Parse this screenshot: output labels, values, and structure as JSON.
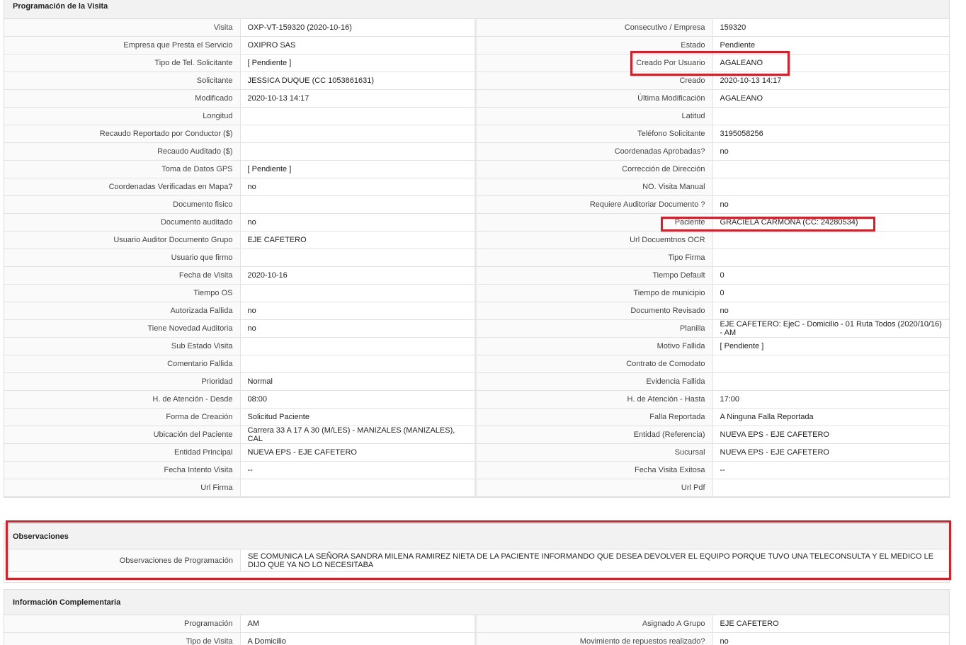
{
  "programacion": {
    "title": "Programación de la Visita",
    "rows": [
      {
        "l1": "Visita",
        "v1": "OXP-VT-159320 (2020-10-16)",
        "l2": "Consecutivo / Empresa",
        "v2": "159320"
      },
      {
        "l1": "Empresa que Presta el Servicio",
        "v1": "OXIPRO SAS",
        "l2": "Estado",
        "v2": "Pendiente"
      },
      {
        "l1": "Tipo de Tel. Solicitante",
        "v1": "[ Pendiente ]",
        "l2": "Creado Por Usuario",
        "v2": "AGALEANO"
      },
      {
        "l1": "Solicitante",
        "v1": "JESSICA DUQUE (CC 1053861631)",
        "l2": "Creado",
        "v2": "2020-10-13 14:17"
      },
      {
        "l1": "Modificado",
        "v1": "2020-10-13 14:17",
        "l2": "Última Modificación",
        "v2": " AGALEANO"
      },
      {
        "l1": "Longitud",
        "v1": "",
        "l2": "Latitud",
        "v2": ""
      },
      {
        "l1": "Recaudo Reportado por Conductor ($)",
        "v1": "",
        "l2": "Teléfono Solicitante",
        "v2": "3195058256"
      },
      {
        "l1": "Recaudo Auditado ($)",
        "v1": "",
        "l2": "Coordenadas Aprobadas?",
        "v2": " no"
      },
      {
        "l1": "Toma de Datos GPS",
        "v1": "[ Pendiente ]",
        "l2": "Corrección de Dirección",
        "v2": ""
      },
      {
        "l1": "Coordenadas Verificadas en Mapa?",
        "v1": " no",
        "l2": "NO. Visita Manual",
        "v2": ""
      },
      {
        "l1": "Documento fisico",
        "v1": "",
        "l2": "Requiere Auditoriar Documento ?",
        "v2": " no"
      },
      {
        "l1": "Documento auditado",
        "v1": " no",
        "l2": "Paciente",
        "v2": "GRACIELA CARMONA (CC: 24280534)"
      },
      {
        "l1": "Usuario Auditor Documento Grupo",
        "v1": "EJE CAFETERO",
        "l2": "Url Docuemtnos OCR",
        "v2": ""
      },
      {
        "l1": "Usuario que firmo",
        "v1": "",
        "l2": "Tipo Firma",
        "v2": ""
      },
      {
        "l1": "Fecha de Visita",
        "v1": " 2020-10-16",
        "l2": "Tiempo Default",
        "v2": "0"
      },
      {
        "l1": "Tiempo OS",
        "v1": "",
        "l2": "Tiempo de municipio",
        "v2": "0"
      },
      {
        "l1": "Autorizada Fallida",
        "v1": " no",
        "l2": "Documento Revisado",
        "v2": " no"
      },
      {
        "l1": "Tiene Novedad Auditoria",
        "v1": " no",
        "l2": "Planilla",
        "v2": "EJE CAFETERO: EjeC - Domicilio - 01 Ruta Todos (2020/10/16) - AM"
      },
      {
        "l1": "Sub Estado Visita",
        "v1": "",
        "l2": "Motivo Fallida",
        "v2": "[ Pendiente ]"
      },
      {
        "l1": "Comentario Fallida",
        "v1": "",
        "l2": "Contrato de Comodato",
        "v2": ""
      },
      {
        "l1": "Prioridad",
        "v1": "Normal",
        "l2": "Evidencia Fallida",
        "v2": ""
      },
      {
        "l1": "H. de Atención - Desde",
        "v1": "08:00",
        "l2": "H. de Atención - Hasta",
        "v2": "17:00"
      },
      {
        "l1": "Forma de Creación",
        "v1": "Solicitud Paciente",
        "l2": "Falla Reportada",
        "v2": "A Ninguna Falla Reportada"
      },
      {
        "l1": "Ubicación del Paciente",
        "v1": "Carrera 33 A 17 A 30 (M/LES) - MANIZALES (MANIZALES), CAL",
        "l2": "Entidad (Referencia)",
        "v2": "NUEVA EPS - EJE CAFETERO"
      },
      {
        "l1": "Entidad Principal",
        "v1": "NUEVA EPS - EJE CAFETERO",
        "l2": "Sucursal",
        "v2": "NUEVA EPS - EJE CAFETERO"
      },
      {
        "l1": "Fecha Intento Visita",
        "v1": " --",
        "l2": "Fecha Visita Exitosa",
        "v2": " --"
      },
      {
        "l1": "Url Firma",
        "v1": "",
        "l2": "Url Pdf",
        "v2": ""
      }
    ]
  },
  "observaciones": {
    "title": "Observaciones",
    "label": "Observaciones de Programación",
    "value": "  SE COMUNICA LA SEÑORA SANDRA MILENA RAMIREZ NIETA DE LA PACIENTE INFORMANDO QUE DESEA DEVOLVER EL EQUIPO PORQUE TUVO UNA TELECONSULTA Y EL MEDICO LE DIJO QUE YA NO LO NECESITABA"
  },
  "informacion": {
    "title": "Información Complementaria",
    "rows": [
      {
        "l1": "Programación",
        "v1": "AM",
        "l2": "Asignado A Grupo",
        "v2": "EJE CAFETERO"
      },
      {
        "l1": "Tipo de Visita",
        "v1": "A Domicilio",
        "l2": "Movimiento de repuestos realizado?",
        "v2": " no"
      }
    ]
  },
  "highlight_color": "#e01b24"
}
